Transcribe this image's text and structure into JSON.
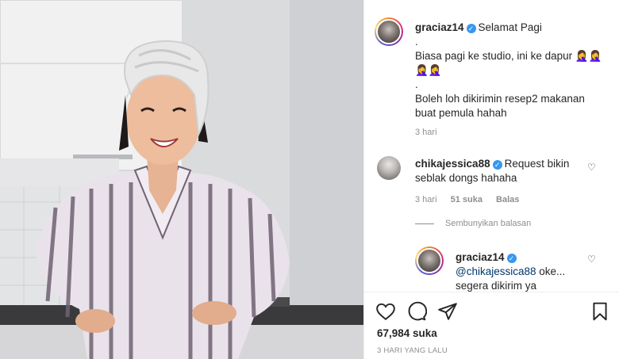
{
  "post": {
    "author": "graciaz14",
    "caption_lines": [
      "Selamat Pagi",
      ".",
      "Biasa pagi ke studio, ini ke dapur 🤦‍♀️🤦‍♀️",
      "🤦‍♀️🤦‍♀️",
      ".",
      "Boleh loh dikirimin resep2 makanan",
      "buat pemula hahah"
    ],
    "age": "3 hari"
  },
  "comment": {
    "author": "chikajessica88",
    "text_line1": "Request bikin",
    "text_line2": "seblak dongs hahaha",
    "age": "3 hari",
    "likes": "51 suka",
    "reply_label": "Balas",
    "hide_replies": "Sembunyikan balasan"
  },
  "reply": {
    "author": "graciaz14",
    "mention": "@chikajessica88",
    "text_tail": " oke...",
    "text_line2": "segera dikirim ya"
  },
  "footer": {
    "likes_count": "67,984 suka",
    "timestamp": "3 HARI YANG LALU"
  },
  "icons": {
    "like": "heart-icon",
    "comment": "comment-icon",
    "share": "paper-plane-icon",
    "save": "bookmark-icon",
    "verified": "verified-badge-icon"
  },
  "colors": {
    "link": "#00376b",
    "meta": "#8e8e8e",
    "verified": "#3897f0",
    "text": "#262626"
  }
}
